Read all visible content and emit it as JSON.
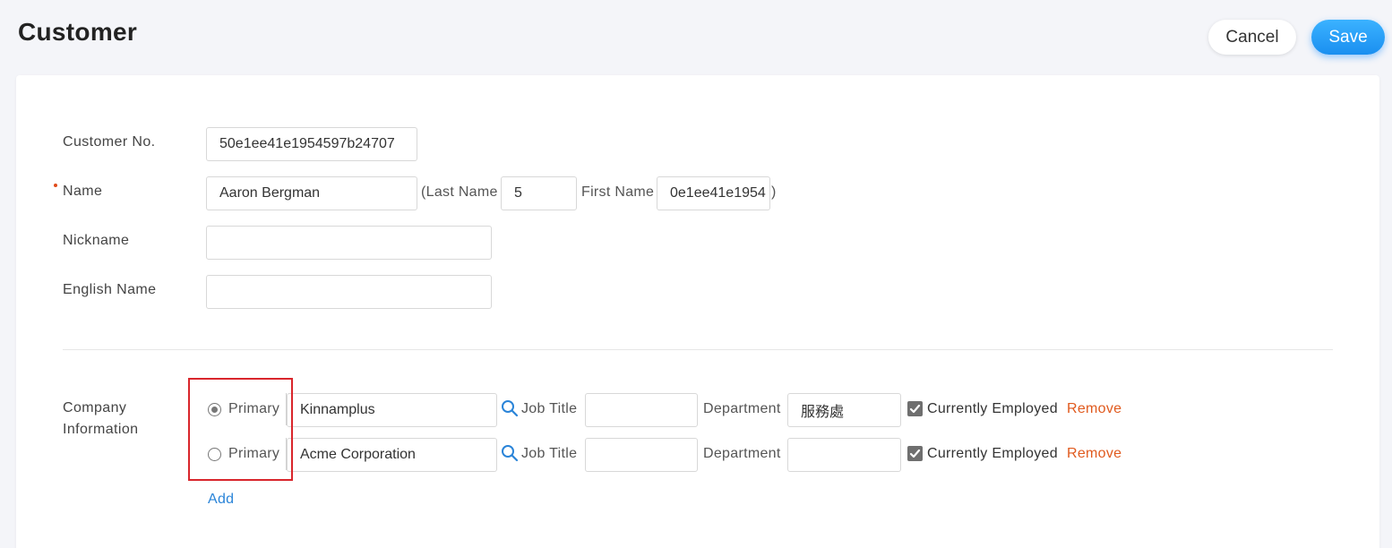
{
  "header": {
    "title": "Customer",
    "cancel_label": "Cancel",
    "save_label": "Save"
  },
  "form": {
    "customer_no": {
      "label": "Customer No.",
      "value": "50e1ee41e1954597b24707"
    },
    "name": {
      "label": "Name",
      "value": "Aaron Bergman",
      "last_name_label": "(Last Name",
      "last_name_value": "5",
      "first_name_label": "First Name",
      "first_name_value": "0e1ee41e1954",
      "close_paren": ")"
    },
    "nickname": {
      "label": "Nickname",
      "value": ""
    },
    "english_name": {
      "label": "English Name",
      "value": ""
    }
  },
  "company_info": {
    "label_line1": "Company",
    "label_line2": "Information",
    "rows": [
      {
        "primary_label": "Primary",
        "primary_checked": true,
        "company": "Kinnamplus",
        "job_title_label": "Job Title",
        "job_title": "",
        "department_label": "Department",
        "department": "服務處",
        "employed_label": "Currently Employed",
        "employed_checked": true,
        "remove_label": "Remove"
      },
      {
        "primary_label": "Primary",
        "primary_checked": false,
        "company": "Acme Corporation",
        "job_title_label": "Job Title",
        "job_title": "",
        "department_label": "Department",
        "department": "",
        "employed_label": "Currently Employed",
        "employed_checked": true,
        "remove_label": "Remove"
      }
    ],
    "add_label": "Add"
  },
  "colors": {
    "accent_blue": "#1a8ff0",
    "remove_orange": "#e05a1e",
    "link_blue": "#2a84d8",
    "highlight_red": "#d9262c"
  },
  "icons": [
    "search-icon",
    "check-icon",
    "radio-icon"
  ]
}
